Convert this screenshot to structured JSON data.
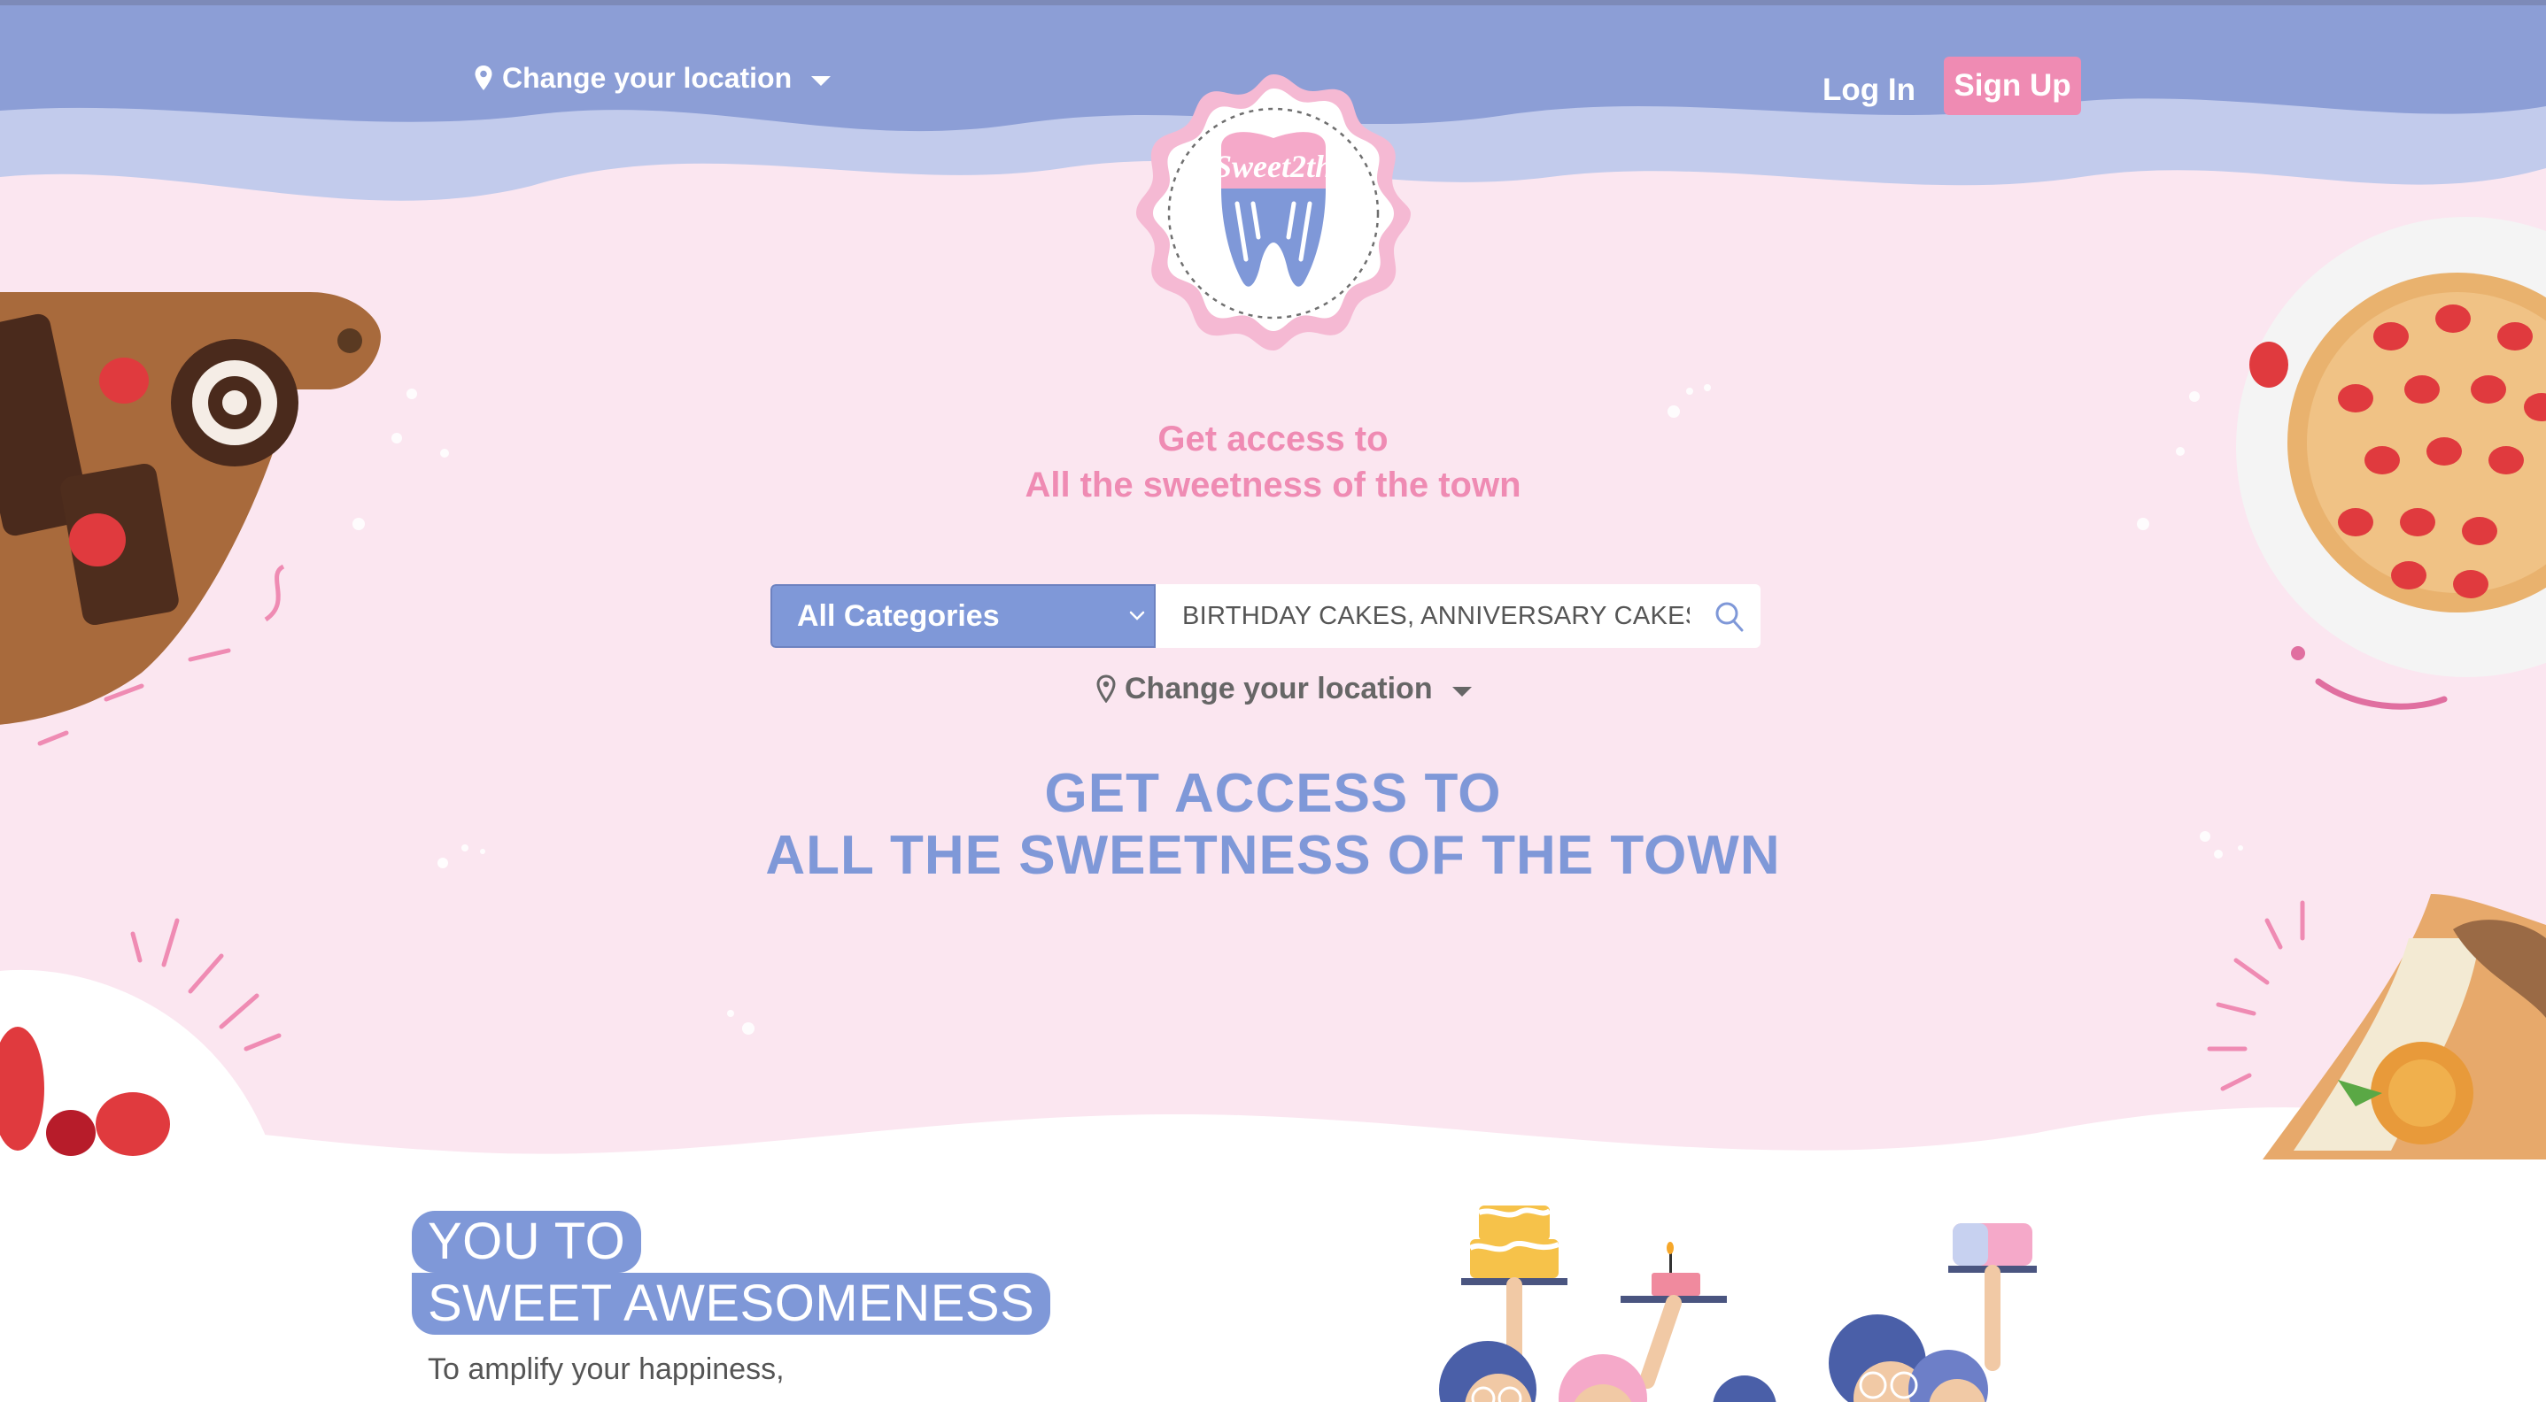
{
  "header": {
    "location_label": "Change your location",
    "login_label": "Log In",
    "signup_label": "Sign Up"
  },
  "logo": {
    "text": "Sweet2th"
  },
  "hero": {
    "tagline_line1": "Get access to",
    "tagline_line2": "All the sweetness of the town",
    "heading_line1": "GET ACCESS TO",
    "heading_line2": "ALL THE SWEETNESS OF THE TOWN"
  },
  "search": {
    "category_selected": "All Categories",
    "placeholder": "BIRTHDAY CAKES, ANNIVERSARY CAKES",
    "icon": "search-icon"
  },
  "location_selector": {
    "label": "Change your location"
  },
  "promo": {
    "title_line1": "YOU TO",
    "title_line2": "SWEET AWESOMENESS",
    "subtitle": "To amplify your happiness,"
  },
  "colors": {
    "header_blue": "#8c9ed6",
    "hero_pink": "#fbe6f0",
    "accent_pink": "#ef8bb3",
    "accent_blue": "#7f98d8"
  }
}
